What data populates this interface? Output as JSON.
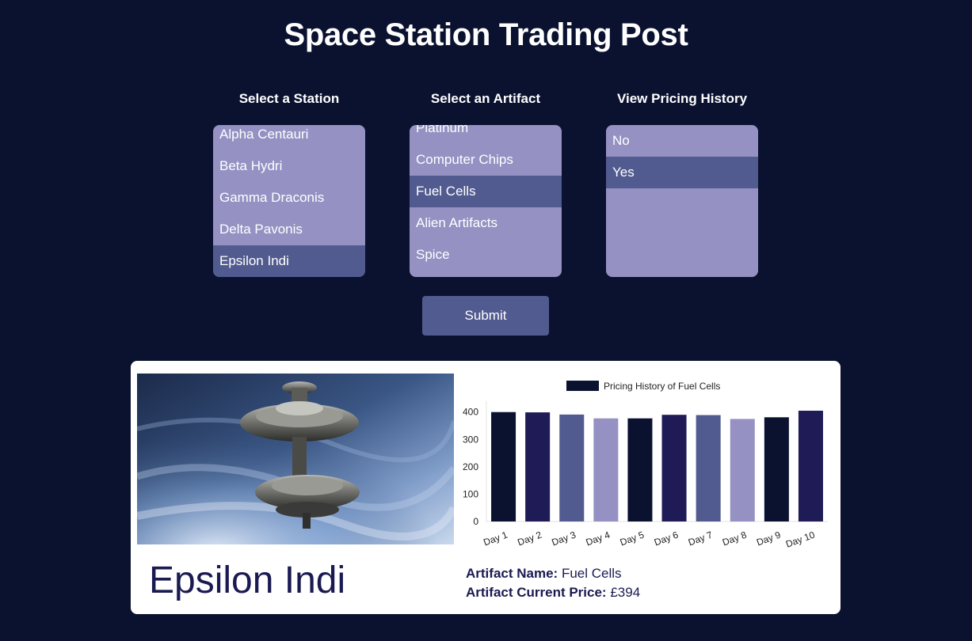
{
  "header": {
    "title": "Space Station Trading Post"
  },
  "station_select": {
    "label": "Select a Station",
    "options": [
      {
        "label": "Alpha Centauri",
        "selected": false
      },
      {
        "label": "Beta Hydri",
        "selected": false
      },
      {
        "label": "Gamma Draconis",
        "selected": false
      },
      {
        "label": "Delta Pavonis",
        "selected": false
      },
      {
        "label": "Epsilon Indi",
        "selected": true
      }
    ]
  },
  "artifact_select": {
    "label": "Select an Artifact",
    "options": [
      {
        "label": "Platinum",
        "selected": false
      },
      {
        "label": "Computer Chips",
        "selected": false
      },
      {
        "label": "Fuel Cells",
        "selected": true
      },
      {
        "label": "Alien Artifacts",
        "selected": false
      },
      {
        "label": "Spice",
        "selected": false
      }
    ]
  },
  "history_select": {
    "label": "View Pricing History",
    "options": [
      {
        "label": "No",
        "selected": false
      },
      {
        "label": "Yes",
        "selected": true
      }
    ]
  },
  "submit_label": "Submit",
  "result": {
    "station_name": "Epsilon Indi",
    "artifact_name_label": "Artifact Name:",
    "artifact_name": "Fuel Cells",
    "price_label": "Artifact Current Price:",
    "price": "£394"
  },
  "colors": {
    "background": "#0b1230",
    "listbox": "#9591c3",
    "selected": "#525b8f",
    "dark_text": "#1a1a52"
  },
  "chart_data": {
    "type": "bar",
    "legend": "Pricing History of Fuel Cells",
    "legend_position": "top",
    "categories": [
      "Day 1",
      "Day 2",
      "Day 3",
      "Day 4",
      "Day 5",
      "Day 6",
      "Day 7",
      "Day 8",
      "Day 9",
      "Day 10"
    ],
    "values": [
      400,
      399,
      391,
      377,
      377,
      390,
      389,
      375,
      381,
      405
    ],
    "bar_colors": [
      "#0b1230",
      "#1e1b56",
      "#525b8f",
      "#9591c3",
      "#0b1230",
      "#1e1b56",
      "#525b8f",
      "#9591c3",
      "#0b1230",
      "#1e1b56"
    ],
    "yticks": [
      0,
      100,
      200,
      300,
      400
    ],
    "ylim": [
      0,
      405
    ],
    "grid": false
  }
}
